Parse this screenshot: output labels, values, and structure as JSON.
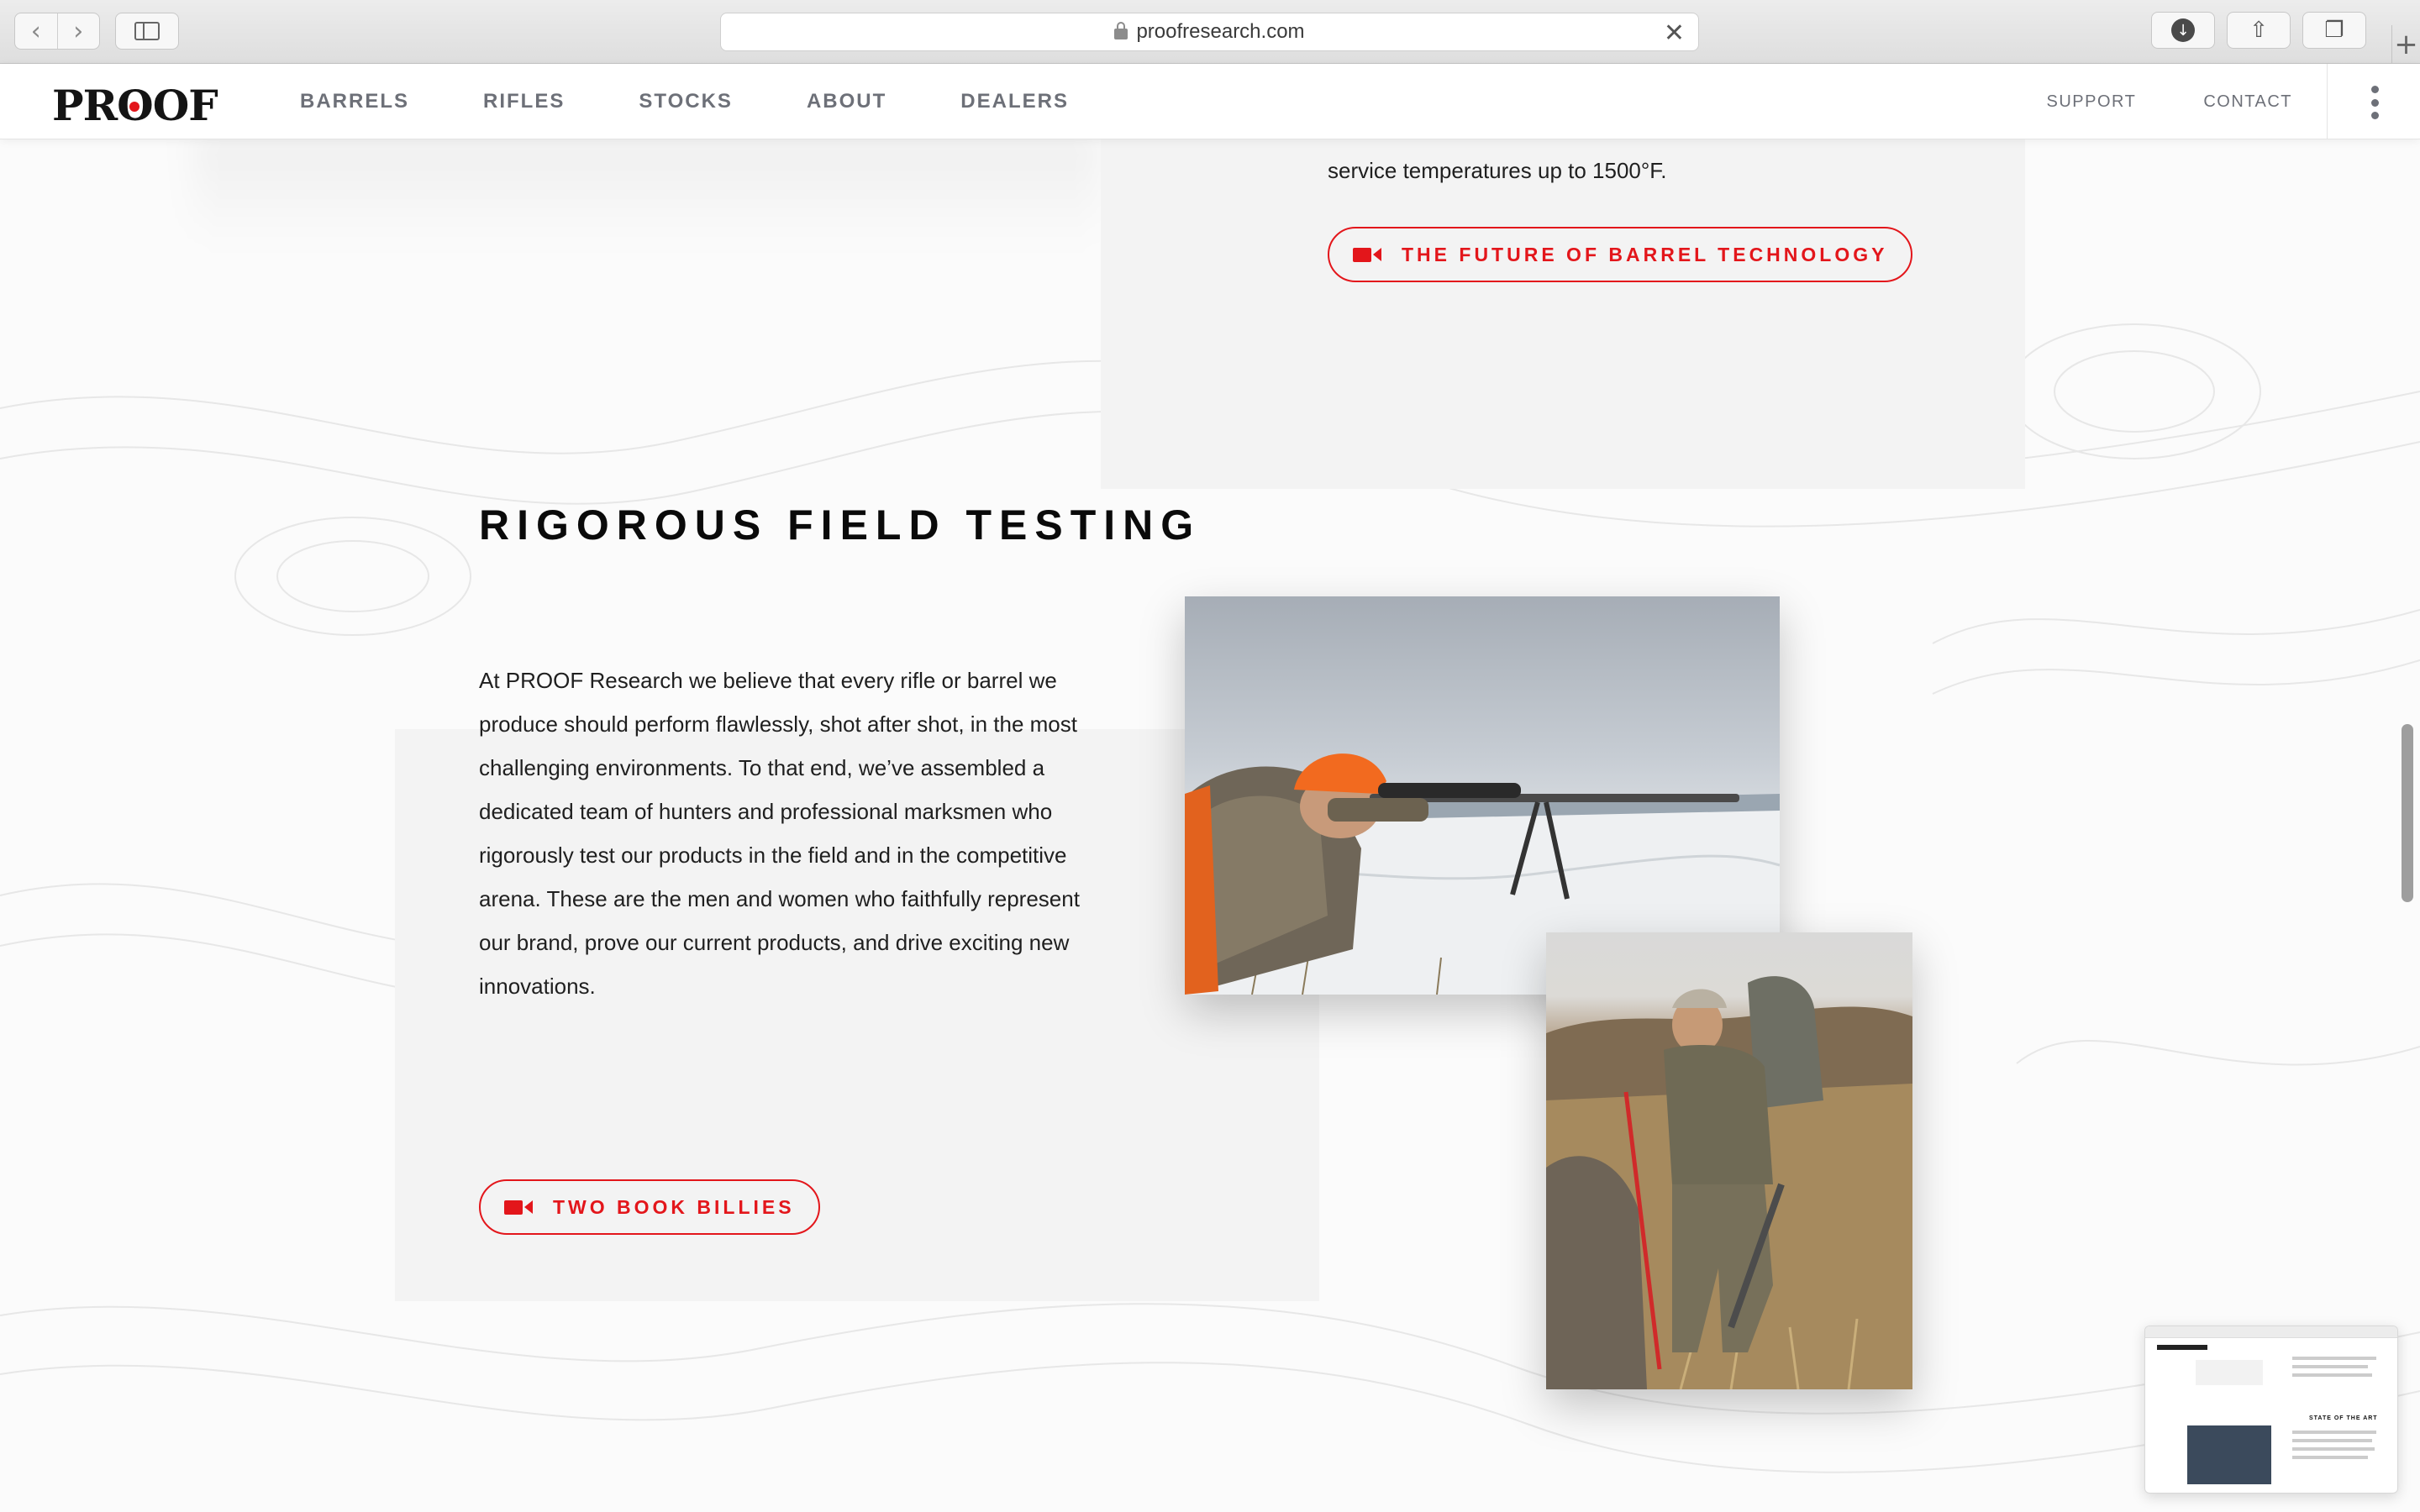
{
  "browser": {
    "url": "proofresearch.com",
    "back_glyph": "‹",
    "forward_glyph": "›",
    "close_glyph": "✕",
    "download_glyph": "↓",
    "share_glyph": "⇧",
    "tabs_glyph": "❐",
    "newtab_glyph": "+"
  },
  "header": {
    "logo": {
      "before": "PR",
      "o": "O",
      "after": "OF"
    },
    "nav": [
      "BARRELS",
      "RIFLES",
      "STOCKS",
      "ABOUT",
      "DEALERS"
    ],
    "utility": [
      "SUPPORT",
      "CONTACT"
    ]
  },
  "upper_section": {
    "text": "service temperatures up to 1500°F.",
    "button_label": "THE FUTURE OF BARREL TECHNOLOGY"
  },
  "field_testing": {
    "title": "RIGOROUS FIELD TESTING",
    "paragraph": "At PROOF Research we believe that every rifle or barrel we produce should perform flawlessly, shot after shot, in the most challenging environments. To that end, we’ve assembled a dedicated team of hunters and professional marksmen who rigorously test our products in the field and in the competitive arena. These are the men and women who faithfully represent our brand, prove our current products, and drive exciting new innovations.",
    "button_label": "TWO BOOK BILLIES"
  },
  "thumbnail": {
    "title": "STATE OF THE ART"
  },
  "colors": {
    "accent_red": "#e3161b",
    "nav_gray": "#6d7078",
    "card_bg": "#f3f3f3"
  }
}
